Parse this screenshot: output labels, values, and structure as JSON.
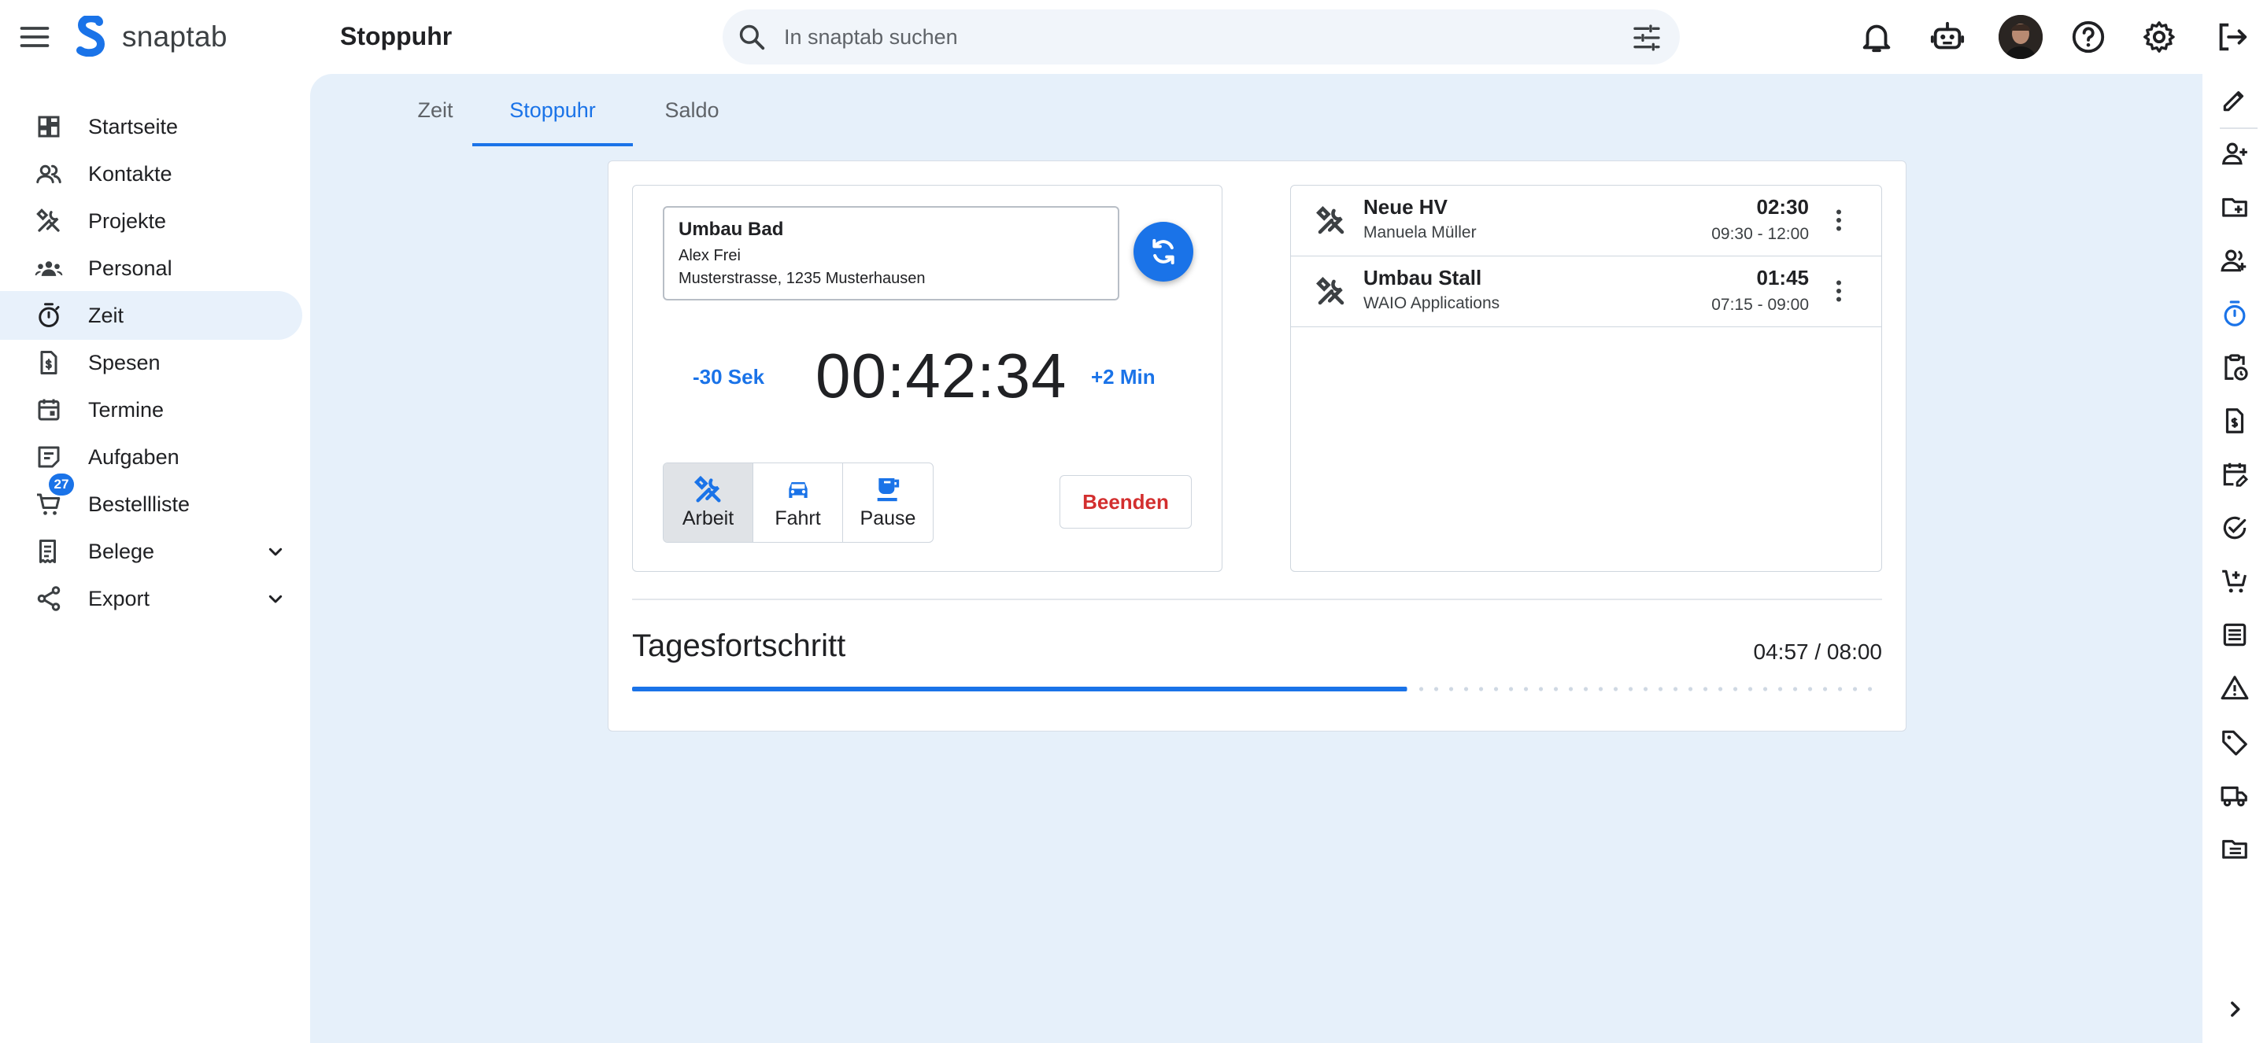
{
  "app": {
    "brand": "snaptab",
    "page_title": "Stoppuhr"
  },
  "search": {
    "placeholder": "In snaptab suchen"
  },
  "top_icons": [
    "bell-icon",
    "robot-icon",
    "avatar",
    "help-icon",
    "settings-icon",
    "logout-icon"
  ],
  "sidebar": {
    "items": [
      {
        "label": "Startseite",
        "icon": "dashboard-icon"
      },
      {
        "label": "Kontakte",
        "icon": "contacts-icon"
      },
      {
        "label": "Projekte",
        "icon": "tools-icon"
      },
      {
        "label": "Personal",
        "icon": "groups-icon"
      },
      {
        "label": "Zeit",
        "icon": "timer-icon",
        "active": true
      },
      {
        "label": "Spesen",
        "icon": "receipt-dollar-icon"
      },
      {
        "label": "Termine",
        "icon": "calendar-icon"
      },
      {
        "label": "Aufgaben",
        "icon": "tasks-icon"
      },
      {
        "label": "Bestellliste",
        "icon": "cart-icon",
        "badge": "27"
      },
      {
        "label": "Belege",
        "icon": "receipt-icon",
        "expandable": true
      },
      {
        "label": "Export",
        "icon": "share-icon",
        "expandable": true
      }
    ]
  },
  "tabs": [
    {
      "label": "Zeit"
    },
    {
      "label": "Stoppuhr",
      "active": true
    },
    {
      "label": "Saldo"
    }
  ],
  "stopwatch": {
    "project": {
      "name": "Umbau Bad",
      "contact": "Alex Frei",
      "address": "Musterstrasse, 1235 Musterhausen"
    },
    "minus_label": "-30 Sek",
    "plus_label": "+2 Min",
    "time": "00:42:34",
    "modes": [
      {
        "label": "Arbeit",
        "icon": "tools-icon",
        "active": true
      },
      {
        "label": "Fahrt",
        "icon": "car-icon"
      },
      {
        "label": "Pause",
        "icon": "coffee-icon"
      }
    ],
    "end_label": "Beenden"
  },
  "entries": [
    {
      "title": "Neue HV",
      "subtitle": "Manuela Müller",
      "duration": "02:30",
      "range": "09:30 - 12:00"
    },
    {
      "title": "Umbau Stall",
      "subtitle": "WAIO Applications",
      "duration": "01:45",
      "range": "07:15 - 09:00"
    }
  ],
  "progress": {
    "title": "Tagesfortschritt",
    "value_text": "04:57 / 08:00",
    "fraction": 0.62
  },
  "colors": {
    "accent": "#1a73e8",
    "danger": "#d32f2f",
    "main_bg": "#e6f0fa",
    "active_nav": "#e8f1fb"
  },
  "right_rail_icons": [
    "edit-icon",
    "add-contact-icon",
    "new-folder-icon",
    "add-person-icon",
    "timer-icon",
    "clipboard-clock-icon",
    "receipt-dollar-icon",
    "calendar-edit-icon",
    "task-check-icon",
    "add-cart-icon",
    "list-icon",
    "warning-icon",
    "tag-icon",
    "truck-icon",
    "folder-list-icon",
    "chevron-right-icon"
  ]
}
